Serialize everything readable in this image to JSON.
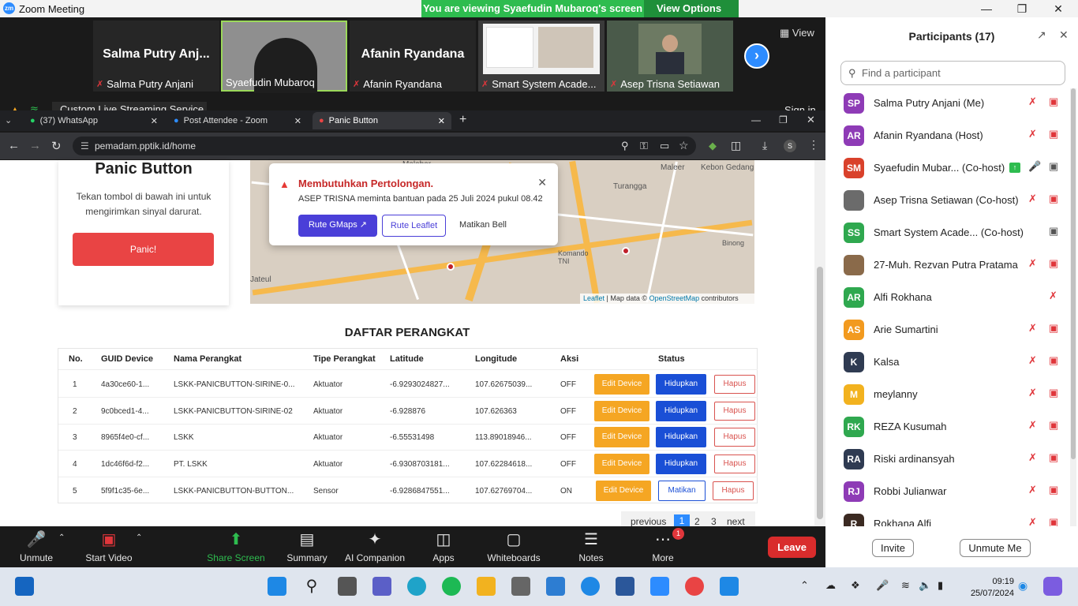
{
  "window": {
    "title": "Zoom Meeting",
    "logo": "zm"
  },
  "share_banner": {
    "text": "You are viewing Syaefudin Mubaroq's screen",
    "view_options": "View Options"
  },
  "strip": {
    "tiles": [
      {
        "name": "Salma Putry Anj...",
        "label": "Salma Putry Anjani",
        "muted": true
      },
      {
        "name": "",
        "label": "Syaefudin Mubaroq",
        "muted": false
      },
      {
        "name": "Afanin Ryandana",
        "label": "Afanin Ryandana",
        "muted": true
      },
      {
        "name": "",
        "label": "Smart System Acade...",
        "muted": true
      },
      {
        "name": "",
        "label": "Asep Trisna Setiawan",
        "muted": true
      }
    ],
    "view_label": "View"
  },
  "stream": {
    "label": "Custom Live Streaming Service",
    "signin": "Sign in"
  },
  "browser": {
    "tabs": [
      {
        "label": "(37) WhatsApp"
      },
      {
        "label": "Post Attendee - Zoom"
      },
      {
        "label": "Panic Button"
      }
    ],
    "url": "pemadam.pptik.id/home"
  },
  "card": {
    "title": "Panic Button",
    "desc": "Tekan tombol di bawah ini untuk mengirimkan sinyal darurat.",
    "button": "Panic!"
  },
  "map": {
    "labels": [
      "Malabar",
      "Maleer",
      "Kebon Gedang",
      "Turangga",
      "Binong",
      "Komando",
      "TNI",
      "Jateul"
    ],
    "attribution_leaflet": "Leaflet",
    "attribution_text": "| Map data ©",
    "attribution_osm": "OpenStreetMap",
    "attribution_tail": "contributors"
  },
  "popup": {
    "heading": "Membutuhkan Pertolongan.",
    "detail": "ASEP TRISNA meminta bantuan pada 25 Juli 2024 pukul 08.42",
    "btn_gmaps": "Rute GMaps",
    "btn_leaflet": "Rute Leaflet",
    "btn_bell": "Matikan Bell"
  },
  "table": {
    "title": "DAFTAR PERANGKAT",
    "headers": [
      "No.",
      "GUID Device",
      "Nama Perangkat",
      "Tipe Perangkat",
      "Latitude",
      "Longitude",
      "Aksi",
      "Status"
    ],
    "rows": [
      {
        "no": "1",
        "guid": "4a30ce60-1...",
        "nama": "LSKK-PANICBUTTON-SIRINE-0...",
        "tipe": "Aktuator",
        "lat": "-6.9293024827...",
        "lon": "107.62675039...",
        "aksi": "OFF",
        "edit": "Edit Device",
        "toggle": "Hidupkan",
        "hapus": "Hapus"
      },
      {
        "no": "2",
        "guid": "9c0bced1-4...",
        "nama": "LSKK-PANICBUTTON-SIRINE-02",
        "tipe": "Aktuator",
        "lat": "-6.928876",
        "lon": "107.626363",
        "aksi": "OFF",
        "edit": "Edit Device",
        "toggle": "Hidupkan",
        "hapus": "Hapus"
      },
      {
        "no": "3",
        "guid": "8965f4e0-cf...",
        "nama": "LSKK",
        "tipe": "Aktuator",
        "lat": "-6.55531498",
        "lon": "113.89018946...",
        "aksi": "OFF",
        "edit": "Edit Device",
        "toggle": "Hidupkan",
        "hapus": "Hapus"
      },
      {
        "no": "4",
        "guid": "1dc46f6d-f2...",
        "nama": "PT. LSKK",
        "tipe": "Aktuator",
        "lat": "-6.9308703181...",
        "lon": "107.62284618...",
        "aksi": "OFF",
        "edit": "Edit Device",
        "toggle": "Hidupkan",
        "hapus": "Hapus"
      },
      {
        "no": "5",
        "guid": "5f9f1c35-6e...",
        "nama": "LSKK-PANICBUTTON-BUTTON...",
        "tipe": "Sensor",
        "lat": "-6.9286847551...",
        "lon": "107.62769704...",
        "aksi": "ON",
        "edit": "Edit Device",
        "toggle": "Matikan",
        "hapus": "Hapus"
      }
    ],
    "pager": {
      "prev": "previous",
      "p1": "1",
      "p2": "2",
      "p3": "3",
      "next": "next"
    }
  },
  "toolbar": {
    "unmute": "Unmute",
    "start_video": "Start Video",
    "share": "Share Screen",
    "summary": "Summary",
    "ai": "AI Companion",
    "apps": "Apps",
    "whiteboards": "Whiteboards",
    "notes": "Notes",
    "more": "More",
    "more_badge": "1",
    "leave": "Leave"
  },
  "participants": {
    "title": "Participants (17)",
    "search_placeholder": "Find a participant",
    "list": [
      {
        "initials": "SP",
        "name": "Salma Putry Anjani (Me)",
        "color": "#8e3bb6"
      },
      {
        "initials": "AR",
        "name": "Afanin Ryandana (Host)",
        "color": "#8e3bb6"
      },
      {
        "initials": "SM",
        "name": "Syaefudin Mubar... (Co-host)",
        "color": "#d9412b"
      },
      {
        "initials": "",
        "name": "Asep Trisna Setiawan (Co-host)",
        "color": "#6b6b6b"
      },
      {
        "initials": "SS",
        "name": "Smart System Acade...  (Co-host)",
        "color": "#2fa84f"
      },
      {
        "initials": "",
        "name": "27-Muh. Rezvan Putra Pratama",
        "color": "#8a6a4a"
      },
      {
        "initials": "AR",
        "name": "Alfi Rokhana",
        "color": "#2fa84f"
      },
      {
        "initials": "AS",
        "name": "Arie Sumartini",
        "color": "#f29a1f"
      },
      {
        "initials": "K",
        "name": "Kalsa",
        "color": "#2f3b52"
      },
      {
        "initials": "M",
        "name": "meylanny",
        "color": "#f2b21f"
      },
      {
        "initials": "RK",
        "name": "REZA Kusumah",
        "color": "#2fa84f"
      },
      {
        "initials": "RA",
        "name": "Riski ardinansyah",
        "color": "#2f3b52"
      },
      {
        "initials": "RJ",
        "name": "Robbi Julianwar",
        "color": "#8e3bb6"
      },
      {
        "initials": "R",
        "name": "Rokhana Alfi",
        "color": "#3b2a22"
      }
    ],
    "invite": "Invite",
    "unmute_me": "Unmute Me"
  },
  "taskbar": {
    "time": "09:19",
    "date": "25/07/2024"
  }
}
